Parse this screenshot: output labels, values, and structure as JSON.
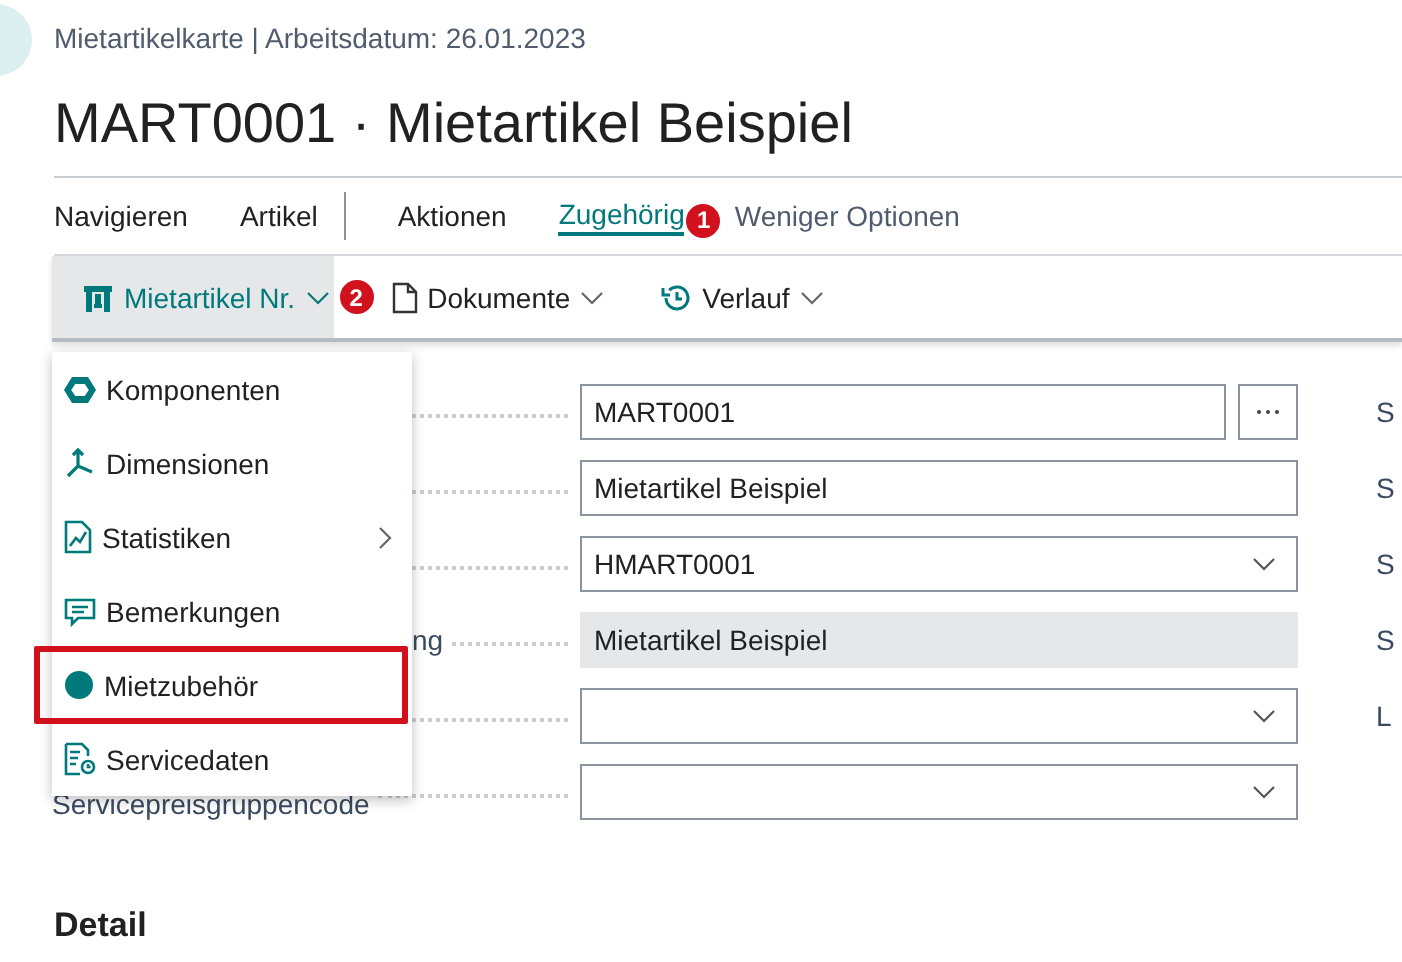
{
  "header": {
    "breadcrumb": "Mietartikelkarte | Arbeitsdatum: 26.01.2023",
    "title": "MART0001 · Mietartikel Beispiel"
  },
  "tabs": [
    {
      "label": "Navigieren",
      "kind": "tab",
      "selected": false,
      "separator_before": false
    },
    {
      "label": "Artikel",
      "kind": "tab",
      "selected": false,
      "separator_before": false
    },
    {
      "label": "Aktionen",
      "kind": "tab",
      "selected": false,
      "separator_before": true
    },
    {
      "label": "Zugehörig",
      "kind": "tab",
      "selected": true,
      "separator_before": false,
      "badge": "1"
    },
    {
      "label": "Weniger Optionen",
      "kind": "toggle",
      "selected": false,
      "separator_before": false
    }
  ],
  "toolbar": [
    {
      "label": "Mietartikel Nr.",
      "selected": true,
      "badge": "2"
    },
    {
      "label": "Dokumente",
      "selected": false
    },
    {
      "label": "Verlauf",
      "selected": false
    }
  ],
  "menu": {
    "items": [
      {
        "label": "Komponenten",
        "submenu": false,
        "highlighted": false
      },
      {
        "label": "Dimensionen",
        "submenu": false,
        "highlighted": false
      },
      {
        "label": "Statistiken",
        "submenu": true,
        "highlighted": false
      },
      {
        "label": "Bemerkungen",
        "submenu": false,
        "highlighted": false
      },
      {
        "label": "Mietzubehör",
        "submenu": false,
        "highlighted": true
      },
      {
        "label": "Servicedaten",
        "submenu": false,
        "highlighted": false
      }
    ]
  },
  "form": {
    "rows": [
      {
        "kind": "lookup",
        "value": "MART0001"
      },
      {
        "kind": "text",
        "value": "Mietartikel Beispiel"
      },
      {
        "kind": "dropdown",
        "value": "HMART0001"
      },
      {
        "kind": "readonly",
        "label": "ng",
        "label_covered": true,
        "value": "Mietartikel Beispiel"
      },
      {
        "kind": "dropdown"
      },
      {
        "kind": "dropdown",
        "label": "Servicepreisgruppencode",
        "label_covered": false
      }
    ],
    "right_labels": [
      "S",
      "S",
      "S",
      "S",
      "L"
    ]
  },
  "section": {
    "title": "Detail"
  }
}
